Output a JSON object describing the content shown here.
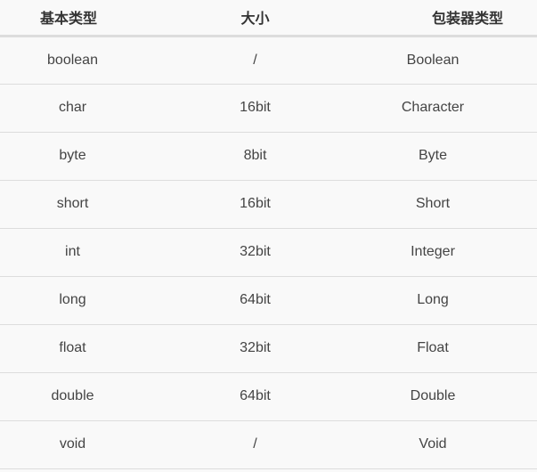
{
  "table": {
    "headers": [
      "基本类型",
      "大小",
      "包装器类型"
    ],
    "rows": [
      [
        "boolean",
        "/",
        "Boolean"
      ],
      [
        "char",
        "16bit",
        "Character"
      ],
      [
        "byte",
        "8bit",
        "Byte"
      ],
      [
        "short",
        "16bit",
        "Short"
      ],
      [
        "int",
        "32bit",
        "Integer"
      ],
      [
        "long",
        "64bit",
        "Long"
      ],
      [
        "float",
        "32bit",
        "Float"
      ],
      [
        "double",
        "64bit",
        "Double"
      ],
      [
        "void",
        "/",
        "Void"
      ]
    ]
  }
}
